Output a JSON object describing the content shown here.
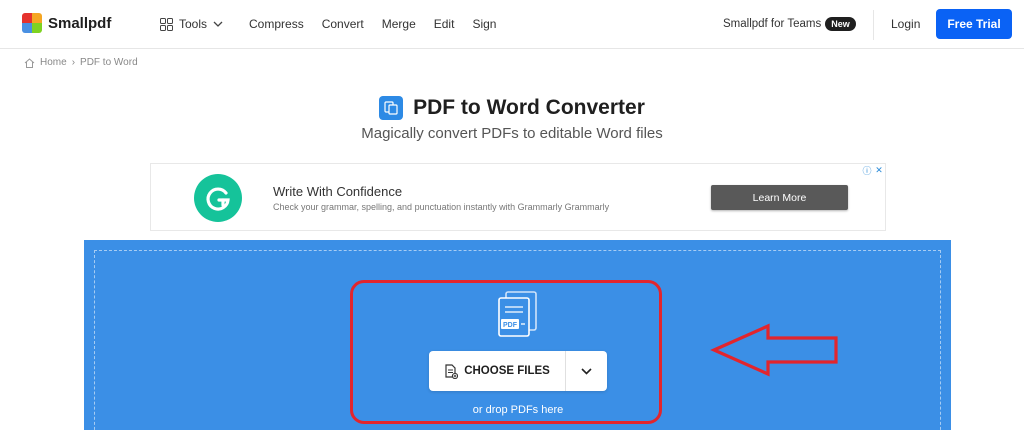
{
  "header": {
    "logo_text": "Smallpdf",
    "nav": {
      "tools_label": "Tools",
      "items": [
        "Compress",
        "Convert",
        "Merge",
        "Edit",
        "Sign"
      ]
    },
    "teams_label": "Smallpdf for Teams",
    "teams_badge": "New",
    "login_label": "Login",
    "trial_label": "Free Trial"
  },
  "breadcrumb": {
    "home": "Home",
    "separator": "›",
    "current": "PDF to Word"
  },
  "hero": {
    "title": "PDF to Word Converter",
    "subtitle": "Magically convert PDFs to editable Word files"
  },
  "ad": {
    "title": "Write With Confidence",
    "description": "Check your grammar, spelling, and punctuation instantly with Grammarly Grammarly",
    "cta": "Learn More",
    "logo_letter": "G"
  },
  "upload": {
    "doc_label": "PDF",
    "choose_label": "CHOOSE FILES",
    "drop_hint": "or drop PDFs here"
  },
  "colors": {
    "brand_blue": "#0a62f5",
    "drop_zone": "#3b8fe6",
    "grammarly": "#15c39a",
    "annotation_red": "#e2252d"
  }
}
